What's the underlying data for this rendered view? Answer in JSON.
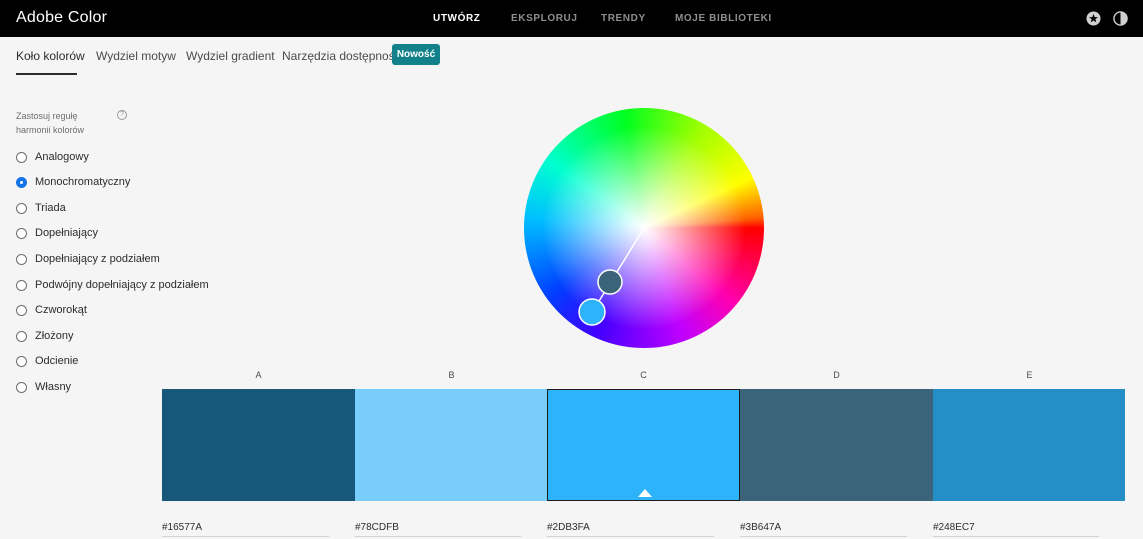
{
  "app": {
    "title": "Adobe Color"
  },
  "top_nav": [
    "UTWÓRZ",
    "EKSPLORUJ",
    "TRENDY",
    "MOJE BIBLIOTEKI"
  ],
  "top_icons": [
    "star-icon",
    "theme-toggle-icon"
  ],
  "subtabs": [
    "Koło kolorów",
    "Wydziel motyw",
    "Wydziel gradient",
    "Narzędzia dostępności"
  ],
  "badge": "Nowość",
  "harmony": {
    "title_line1": "Zastosuj regułę",
    "title_line2": "harmonii kolorów",
    "help": "?",
    "selected": "Monochromatyczny",
    "options": [
      "Analogowy",
      "Monochromatyczny",
      "Triada",
      "Dopełniający",
      "Dopełniający z podziałem",
      "Podwójny dopełniający z podziałem",
      "Czworokąt",
      "Złożony",
      "Odcienie",
      "Własny"
    ]
  },
  "swatches": [
    {
      "letter": "A",
      "color": "#16577A",
      "hex": "#16577A"
    },
    {
      "letter": "B",
      "color": "#78CDFB",
      "hex": "#78CDFB"
    },
    {
      "letter": "C",
      "color": "#2DB3FA",
      "hex": "#2DB3FA",
      "selected": true
    },
    {
      "letter": "D",
      "color": "#3B647A",
      "hex": "#3B647A"
    },
    {
      "letter": "E",
      "color": "#248EC7",
      "hex": "#248EC7"
    }
  ],
  "colors": {
    "accent": "#1473e6",
    "badge": "#12818a",
    "topbar": "#000000"
  }
}
